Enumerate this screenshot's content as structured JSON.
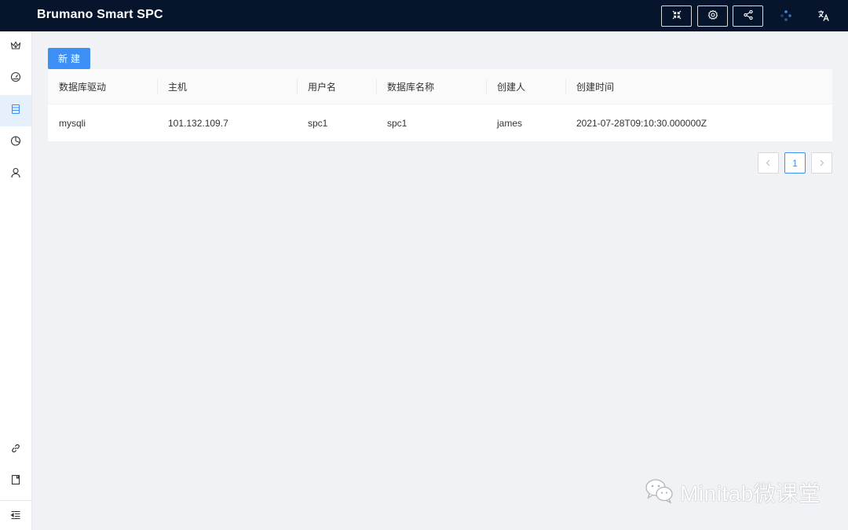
{
  "header": {
    "title": "Brumano Smart SPC",
    "buttons": [
      {
        "icon": "fullscreen-exit-icon"
      },
      {
        "icon": "settings-icon"
      },
      {
        "icon": "share-icon"
      }
    ],
    "icons": [
      "loading-dots-icon",
      "translate-icon"
    ]
  },
  "sidebar": {
    "items": [
      {
        "icon": "crown-icon",
        "active": false
      },
      {
        "icon": "dashboard-icon",
        "active": false
      },
      {
        "icon": "database-icon",
        "active": true
      },
      {
        "icon": "pie-chart-icon",
        "active": false
      },
      {
        "icon": "user-icon",
        "active": false
      }
    ],
    "bottom_items": [
      {
        "icon": "link-icon"
      },
      {
        "icon": "book-icon"
      },
      {
        "icon": "menu-fold-icon"
      }
    ]
  },
  "toolbar": {
    "new_label": "新建"
  },
  "table": {
    "columns": [
      "数据库驱动",
      "主机",
      "用户名",
      "数据库名称",
      "创建人",
      "创建时间"
    ],
    "rows": [
      [
        "mysqli",
        "101.132.109.7",
        "spc1",
        "spc1",
        "james",
        "2021-07-28T09:10:30.000000Z"
      ]
    ]
  },
  "pagination": {
    "current": "1"
  },
  "watermark": {
    "text": "Minitab微课堂"
  },
  "colors": {
    "header_bg": "#06152b",
    "primary": "#3d8ff5",
    "page_bg": "#f0f2f5"
  }
}
